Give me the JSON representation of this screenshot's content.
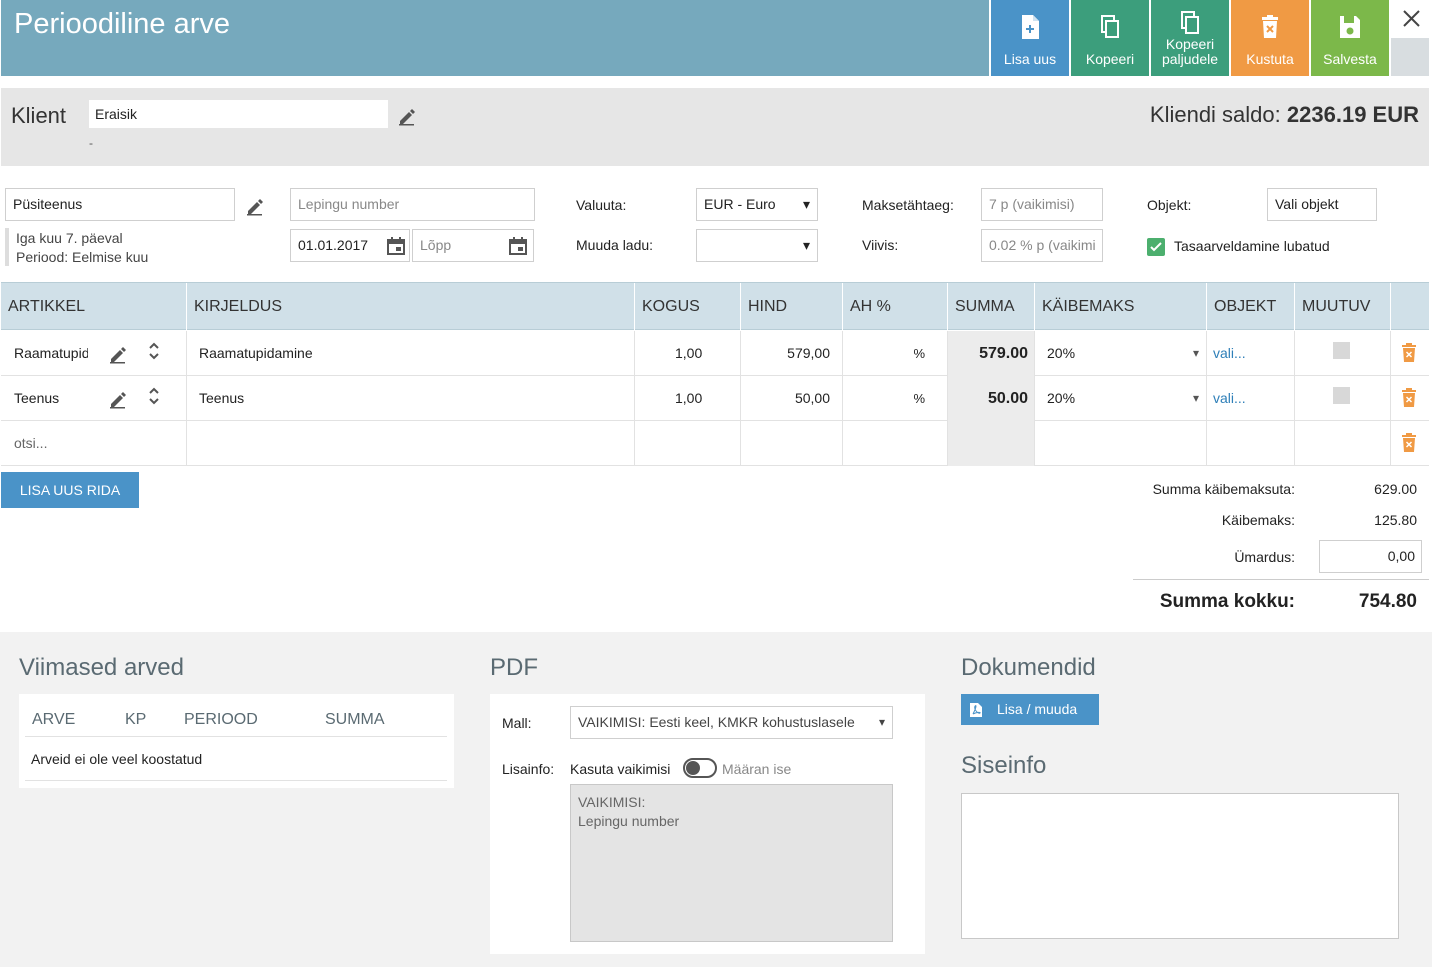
{
  "header": {
    "title": "Perioodiline arve",
    "buttons": {
      "add_new": "Lisa uus",
      "copy": "Kopeeri",
      "copy_many": "Kopeeri paljudele",
      "delete": "Kustuta",
      "save": "Salvesta"
    },
    "colors": {
      "title_bar": "#76a9bd",
      "blue": "#4a93c8",
      "green": "#3c9e7c",
      "orange": "#f09a44",
      "lime": "#7cb84a"
    }
  },
  "client": {
    "label": "Klient",
    "value": "Eraisik",
    "sub": "-",
    "balance_label": "Kliendi saldo:",
    "balance_value": "2236.19 EUR"
  },
  "form": {
    "service": "Püsiteenus",
    "schedule_line1": "Iga kuu 7. päeval",
    "schedule_line2": "Periood: Eelmise kuu",
    "contract_placeholder": "Lepingu number",
    "start_date": "01.01.2017",
    "end_placeholder": "Lõpp",
    "currency_label": "Valuuta:",
    "currency_value": "EUR - Euro",
    "warehouse_label": "Muuda ladu:",
    "warehouse_value": "",
    "due_label": "Maksetähtaeg:",
    "due_placeholder": "7 p (vaikimisi)",
    "penalty_label": "Viivis:",
    "penalty_placeholder": "0.02 % p (vaikimi",
    "object_label": "Objekt:",
    "object_value": "Vali objekt",
    "offset_label": "Tasaarveldamine lubatud"
  },
  "table": {
    "headers": [
      "ARTIKKEL",
      "KIRJELDUS",
      "KOGUS",
      "HIND",
      "AH %",
      "SUMMA",
      "KÄIBEMAKS",
      "OBJEKT",
      "MUUTUV"
    ],
    "rows": [
      {
        "article": "Raamatupida",
        "description": "Raamatupidamine",
        "qty": "1,00",
        "price": "579,00",
        "discount_unit": "%",
        "sum": "579.00",
        "vat": "20%",
        "object": "vali..."
      },
      {
        "article": "Teenus",
        "description": "Teenus",
        "qty": "1,00",
        "price": "50,00",
        "discount_unit": "%",
        "sum": "50.00",
        "vat": "20%",
        "object": "vali..."
      }
    ],
    "search_placeholder": "otsi..."
  },
  "add_row": "LISA UUS RIDA",
  "totals": {
    "net_label": "Summa käibemaksuta:",
    "net_value": "629.00",
    "vat_label": "Käibemaks:",
    "vat_value": "125.80",
    "rounding_label": "Ümardus:",
    "rounding_value": "0,00",
    "total_label": "Summa kokku:",
    "total_value": "754.80"
  },
  "recent": {
    "title": "Viimased arved",
    "headers": [
      "ARVE",
      "KP",
      "PERIOOD",
      "SUMMA"
    ],
    "empty": "Arveid ei ole veel koostatud"
  },
  "pdf": {
    "title": "PDF",
    "template_label": "Mall:",
    "template_value": "VAIKIMISI: Eesti keel, KMKR kohustuslasele",
    "extra_label": "Lisainfo:",
    "use_default": "Kasuta vaikimisi",
    "set_own": "Määran ise",
    "default_line1": "VAIKIMISI:",
    "default_line2": "Lepingu number"
  },
  "documents": {
    "title": "Dokumendid",
    "add_edit": "Lisa / muuda"
  },
  "internal": {
    "title": "Siseinfo"
  }
}
